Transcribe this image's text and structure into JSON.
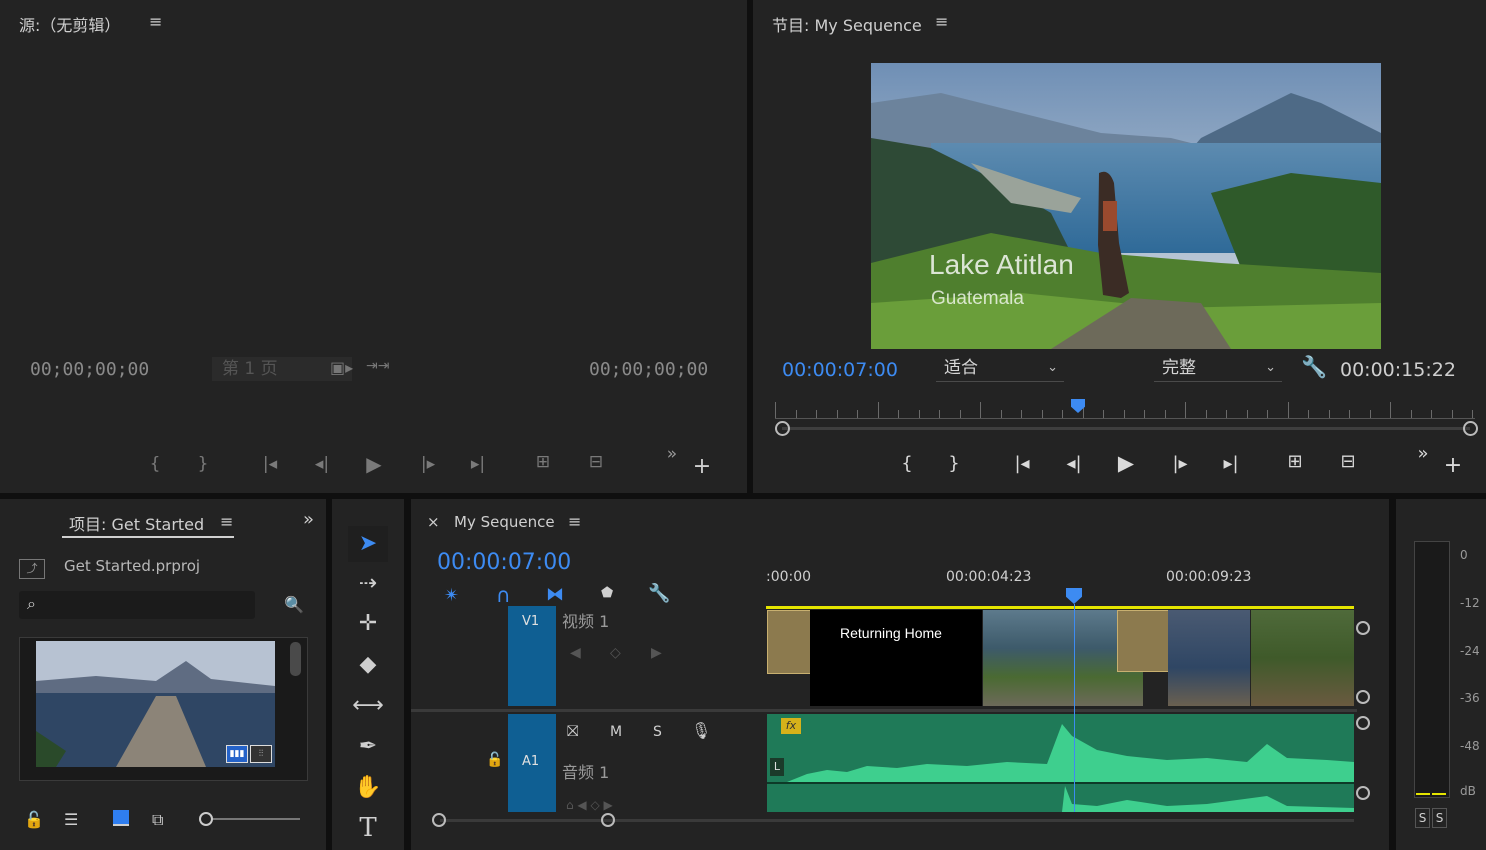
{
  "source_panel": {
    "title": "源:（无剪辑）",
    "menu_icon": "hamburger-icon",
    "timecode_left": "00;00;00;00",
    "timecode_right": "00;00;00;00",
    "page_label": "第 1 页"
  },
  "program_panel": {
    "title": "节目: My Sequence",
    "current_time": "00:00:07:00",
    "fit_select": "适合",
    "quality_select": "完整",
    "duration": "00:00:15:22",
    "overlay_title": "Lake Atitlan",
    "overlay_subtitle": "Guatemala"
  },
  "project_panel": {
    "tab_label": "项目: Get Started",
    "file_name": "Get Started.prproj",
    "search_placeholder": ""
  },
  "timeline": {
    "tab_label": "My Sequence",
    "close_glyph": "×",
    "current_time": "00:00:07:00",
    "ruler_labels": [
      ":00:00",
      "00:00:04:23",
      "00:00:09:23"
    ],
    "v1_label": "V1",
    "v1_name": "视频 1",
    "a1_label": "A1",
    "a1_name": "音频 1",
    "a1_m": "M",
    "a1_s": "S",
    "clip_title": "Returning Home",
    "fx_badge": "fx",
    "channel_l": "L"
  },
  "audio_meter": {
    "labels": [
      "0",
      "-12",
      "-24",
      "-36",
      "-48",
      "dB"
    ],
    "solo_buttons": [
      "S",
      "S"
    ]
  },
  "colors": {
    "accent_blue": "#3d8bf2",
    "audio_green": "#1f7a58",
    "track_blue": "#0f5f93",
    "work_area_yellow": "#e5e500"
  }
}
